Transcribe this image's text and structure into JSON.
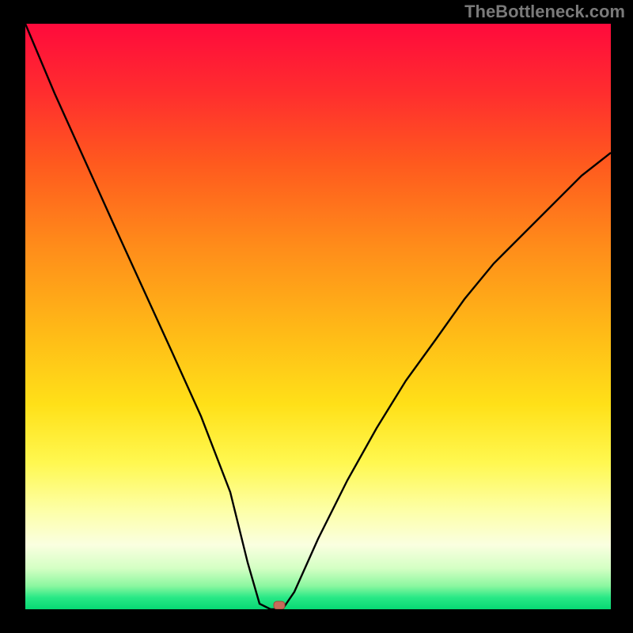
{
  "watermark": "TheBottleneck.com",
  "chart_data": {
    "type": "line",
    "title": "",
    "xlabel": "",
    "ylabel": "",
    "xlim": [
      0,
      100
    ],
    "ylim": [
      0,
      100
    ],
    "grid": false,
    "background_gradient": {
      "top": "#ff0a3c",
      "mid": "#ffe018",
      "bottom": "#07d873"
    },
    "series": [
      {
        "name": "bottleneck-curve",
        "color": "#000000",
        "x": [
          0,
          5,
          10,
          15,
          20,
          25,
          30,
          35,
          38,
          40,
          42,
          44,
          46,
          50,
          55,
          60,
          65,
          70,
          75,
          80,
          85,
          90,
          95,
          100
        ],
        "y": [
          100,
          88,
          77,
          66,
          55,
          44,
          33,
          20,
          8,
          1,
          0,
          0,
          3,
          12,
          22,
          31,
          39,
          46,
          53,
          59,
          64,
          69,
          74,
          78
        ]
      }
    ],
    "markers": [
      {
        "name": "optimal-point",
        "x": 43,
        "y": 0,
        "color": "#c76b5a",
        "shape": "rounded-rect"
      }
    ]
  }
}
